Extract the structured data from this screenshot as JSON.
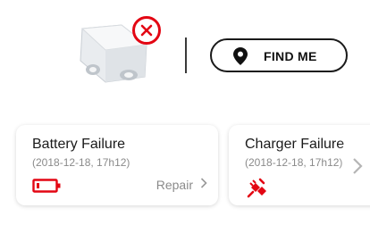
{
  "device": {
    "image": "emergency-light-device",
    "status_icon": "error-x-icon",
    "status_color": "#e30613"
  },
  "find_me": {
    "label": "FIND ME",
    "icon": "location-pin-icon"
  },
  "cards": [
    {
      "title": "Battery Failure",
      "date": "(2018-12-18, 17h12)",
      "icon": "battery-empty-icon",
      "action_label": "Repair"
    },
    {
      "title": "Charger Failure",
      "date": "(2018-12-18, 17h12)",
      "icon": "unplugged-charger-icon"
    }
  ],
  "colors": {
    "accent": "#e30613",
    "muted_text": "#8a8a8a"
  }
}
